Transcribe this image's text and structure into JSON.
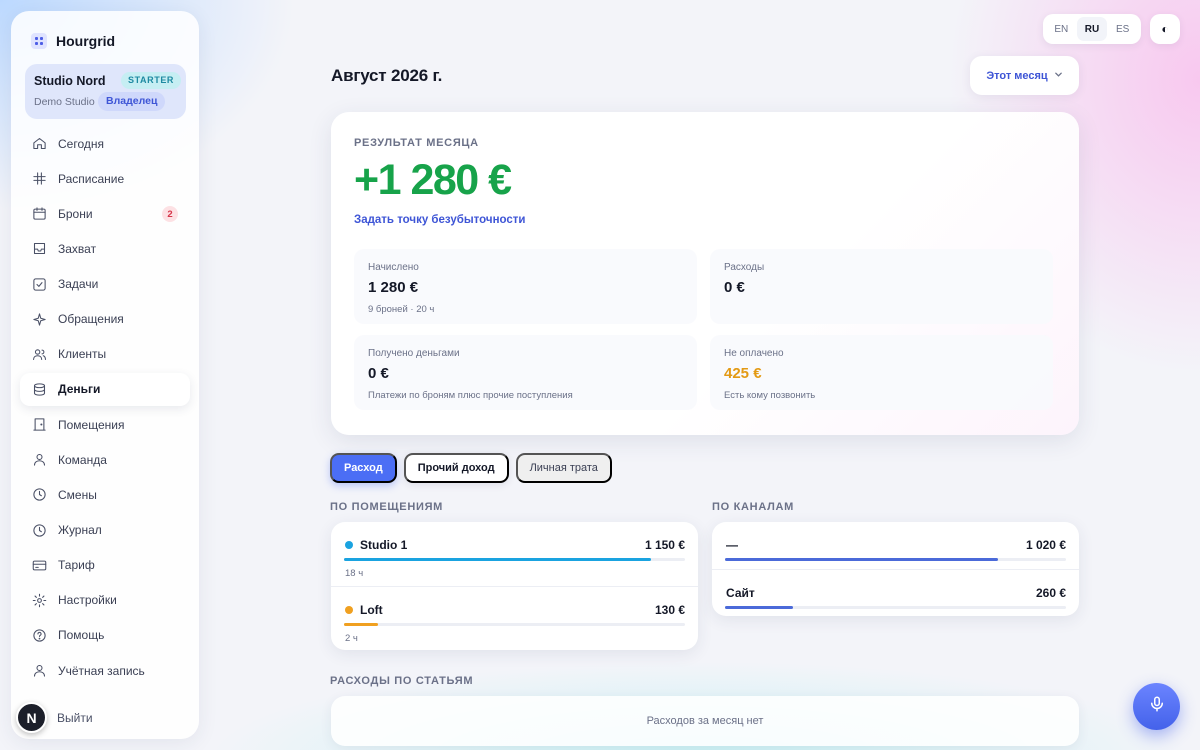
{
  "app": {
    "name": "Hourgrid"
  },
  "studio": {
    "name": "Studio Nord",
    "plan": "STARTER",
    "workspace": "Demo Studio",
    "role": "Владелец"
  },
  "nav": {
    "items": [
      {
        "label": "Сегодня",
        "icon": "home-icon"
      },
      {
        "label": "Расписание",
        "icon": "grid-icon"
      },
      {
        "label": "Брони",
        "icon": "calendar-icon",
        "badge": "2"
      },
      {
        "label": "Захват",
        "icon": "inbox-icon"
      },
      {
        "label": "Задачи",
        "icon": "check-square-icon"
      },
      {
        "label": "Обращения",
        "icon": "sparkle-icon"
      },
      {
        "label": "Клиенты",
        "icon": "users-icon"
      },
      {
        "label": "Деньги",
        "icon": "database-icon",
        "active": true
      },
      {
        "label": "Помещения",
        "icon": "door-icon"
      },
      {
        "label": "Команда",
        "icon": "user-icon"
      },
      {
        "label": "Смены",
        "icon": "clock-icon"
      },
      {
        "label": "Журнал",
        "icon": "clock-icon"
      },
      {
        "label": "Тариф",
        "icon": "credit-card-icon"
      },
      {
        "label": "Настройки",
        "icon": "gear-icon"
      },
      {
        "label": "Помощь",
        "icon": "help-icon"
      },
      {
        "label": "Учётная запись",
        "icon": "account-icon"
      }
    ],
    "logout": "Выйти",
    "avatar_letter": "N"
  },
  "lang": {
    "options": [
      "EN",
      "RU",
      "ES"
    ],
    "active": "RU"
  },
  "theme_toggle": "◐",
  "header": {
    "title": "Август 2026 г.",
    "period": "Этот месяц"
  },
  "summary": {
    "eyebrow": "РЕЗУЛЬТАТ МЕСЯЦА",
    "result": "+1 280 €",
    "link": "Задать точку безубыточности",
    "stats": {
      "accrued": {
        "label": "Начислено",
        "value": "1 280 €",
        "note": "9 броней · 20 ч"
      },
      "expenses": {
        "label": "Расходы",
        "value": "0 €",
        "note": ""
      },
      "received": {
        "label": "Получено деньгами",
        "value": "0 €",
        "note": "Платежи по броням плюс прочие поступления"
      },
      "unpaid": {
        "label": "Не оплачено",
        "value": "425 €",
        "note": "Есть кому позвонить"
      }
    }
  },
  "tabs": {
    "expense": "Расход",
    "other_income": "Прочий доход",
    "personal": "Личная трата"
  },
  "rooms": {
    "title": "ПО ПОМЕЩЕНИЯМ",
    "items": [
      {
        "name": "Studio 1",
        "amount": "1 150 €",
        "hours": "18 ч",
        "share": 0.9,
        "color": "#1aa3e0"
      },
      {
        "name": "Loft",
        "amount": "130 €",
        "hours": "2 ч",
        "share": 0.1,
        "color": "#f0a020"
      }
    ]
  },
  "channels": {
    "title": "ПО КАНАЛАМ",
    "items": [
      {
        "name": "—",
        "amount": "1 020 €",
        "share": 0.8,
        "color": "#4b6ad9"
      },
      {
        "name": "Сайт",
        "amount": "260 €",
        "share": 0.2,
        "color": "#4b6ad9"
      }
    ]
  },
  "expenses_by_item": {
    "title": "РАСХОДЫ ПО СТАТЬЯМ",
    "empty": "Расходов за месяц нет"
  }
}
